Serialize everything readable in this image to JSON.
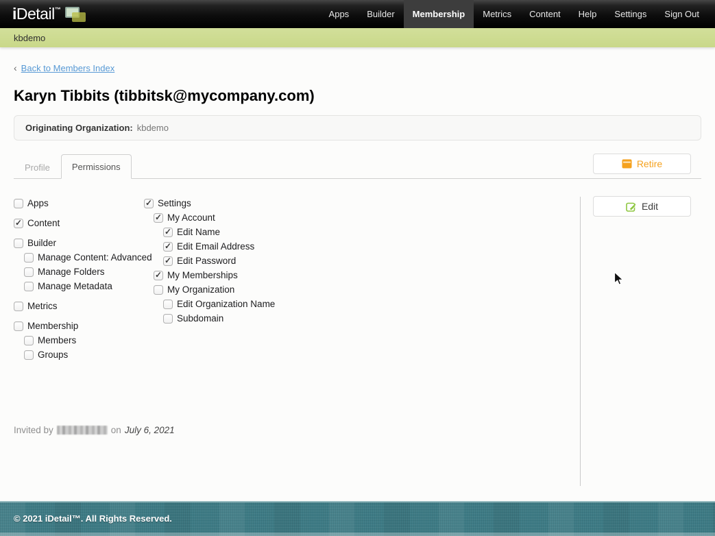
{
  "nav": {
    "brand_i": "i",
    "brand_rest": "Detail",
    "brand_tm": "™",
    "items": [
      {
        "label": "Apps",
        "active": false
      },
      {
        "label": "Builder",
        "active": false
      },
      {
        "label": "Membership",
        "active": true
      },
      {
        "label": "Metrics",
        "active": false
      },
      {
        "label": "Content",
        "active": false
      },
      {
        "label": "Help",
        "active": false
      },
      {
        "label": "Settings",
        "active": false
      },
      {
        "label": "Sign Out",
        "active": false
      }
    ]
  },
  "org_bar": {
    "label": "kbdemo"
  },
  "page": {
    "back_chevron": "‹",
    "back_link": "Back to Members Index",
    "title": "Karyn Tibbits (tibbitsk@mycompany.com)"
  },
  "origin_box": {
    "label": "Originating Organization:",
    "value": "kbdemo"
  },
  "tabs": [
    {
      "label": "Profile",
      "active": false
    },
    {
      "label": "Permissions",
      "active": true
    }
  ],
  "actions": {
    "retire_label": "Retire",
    "edit_label": "Edit"
  },
  "permissions": {
    "left_column": [
      {
        "label": "Apps",
        "checked": false,
        "level": 0,
        "gap": false
      },
      {
        "label": "Content",
        "checked": true,
        "level": 0,
        "gap": true
      },
      {
        "label": "Builder",
        "checked": false,
        "level": 0,
        "gap": true
      },
      {
        "label": "Manage Content: Advanced",
        "checked": false,
        "level": 1,
        "gap": false
      },
      {
        "label": "Manage Folders",
        "checked": false,
        "level": 1,
        "gap": false
      },
      {
        "label": "Manage Metadata",
        "checked": false,
        "level": 1,
        "gap": false
      },
      {
        "label": "Metrics",
        "checked": false,
        "level": 0,
        "gap": true
      },
      {
        "label": "Membership",
        "checked": false,
        "level": 0,
        "gap": true
      },
      {
        "label": "Members",
        "checked": false,
        "level": 1,
        "gap": false
      },
      {
        "label": "Groups",
        "checked": false,
        "level": 1,
        "gap": false
      }
    ],
    "settings_column": [
      {
        "label": "Settings",
        "checked": true,
        "level": 0,
        "gap": false
      },
      {
        "label": "My Account",
        "checked": true,
        "level": 1,
        "gap": false
      },
      {
        "label": "Edit Name",
        "checked": true,
        "level": 2,
        "gap": false
      },
      {
        "label": "Edit Email Address",
        "checked": true,
        "level": 2,
        "gap": false
      },
      {
        "label": "Edit Password",
        "checked": true,
        "level": 2,
        "gap": false
      },
      {
        "label": "My Memberships",
        "checked": true,
        "level": 1,
        "gap": false
      },
      {
        "label": "My Organization",
        "checked": false,
        "level": 1,
        "gap": false
      },
      {
        "label": "Edit Organization Name",
        "checked": false,
        "level": 2,
        "gap": false
      },
      {
        "label": "Subdomain",
        "checked": false,
        "level": 2,
        "gap": false
      }
    ]
  },
  "invited": {
    "prefix": "Invited by",
    "connector": "on",
    "date": "July 6, 2021"
  },
  "footer": {
    "copyright": "© 2021 iDetail™.  All Rights Reserved."
  },
  "colors": {
    "accent_orange": "#F5A21F",
    "accent_green": "#8DC63F",
    "link_blue": "#5799D5",
    "bar_green": "#CCDC8F",
    "footer_teal": "#3E7B85",
    "nav_black": "#000000"
  }
}
